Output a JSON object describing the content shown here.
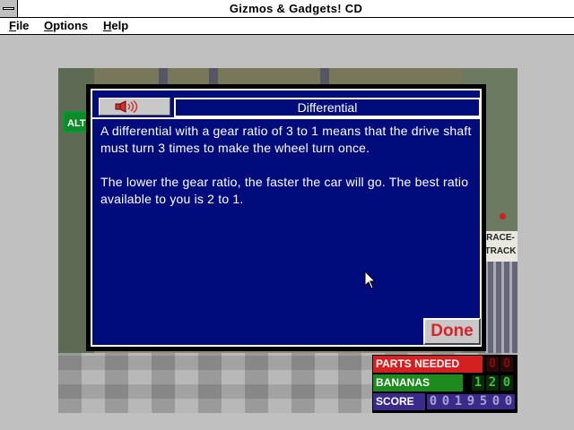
{
  "window": {
    "title": "Gizmos & Gadgets! CD"
  },
  "menu": [
    {
      "label": "File",
      "accel": "F",
      "rest": "ile"
    },
    {
      "label": "Options",
      "accel": "O",
      "rest": "ptions"
    },
    {
      "label": "Help",
      "accel": "H",
      "rest": "elp"
    }
  ],
  "scene": {
    "left_sign": "ALT",
    "race_sign_line1": "RACE-",
    "race_sign_line2": "TRACK"
  },
  "dialog": {
    "title": "Differential",
    "sound_icon": "speaker-icon",
    "paragraphs": [
      "A differential with a gear ratio of 3 to 1 means that the drive shaft must turn 3 times to make the wheel turn once.",
      "The lower the gear ratio, the faster the car will go. The best ratio available to you is 2 to 1."
    ],
    "done_label": "Done"
  },
  "hud": {
    "parts_label": "PARTS NEEDED",
    "parts_digits": [
      "0",
      "0"
    ],
    "bananas_label": "BANANAS",
    "bananas_digits": [
      "1",
      "2",
      "0"
    ],
    "score_label": "SCORE",
    "score_digits": [
      "0",
      "0",
      "1",
      "9",
      "5",
      "0",
      "0"
    ]
  },
  "colors": {
    "dialog_bg": "#000c7b",
    "done_text": "#d8232a",
    "parts": "#d42020",
    "bananas": "#1c8a1c",
    "score": "#3a2a8a"
  }
}
